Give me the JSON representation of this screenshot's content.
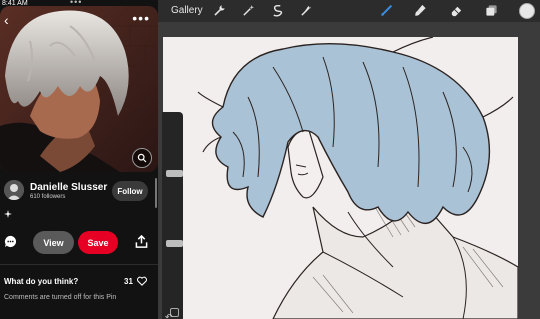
{
  "status": {
    "time": "8:41 AM",
    "dots": "•••"
  },
  "pin": {
    "author": "Danielle Slusser",
    "followers": "610 followers",
    "follow_label": "Follow",
    "view_label": "View",
    "save_label": "Save",
    "question": "What do you think?",
    "likes": "31",
    "comments_off": "Comments are turned off for this Pin",
    "more_label": "•••",
    "back_glyph": "‹",
    "icons": [
      "chevron-left-icon",
      "more-icon",
      "lens-icon",
      "sparkle-icon",
      "comment-icon",
      "share-icon",
      "heart-icon"
    ]
  },
  "procreate": {
    "gallery_label": "Gallery",
    "undo_glyph": "↶",
    "icons": [
      "wrench-icon",
      "magic-wand-icon",
      "selection-icon",
      "transform-icon",
      "brush-icon",
      "smudge-icon",
      "eraser-icon",
      "layers-icon",
      "color-icon"
    ],
    "colors": {
      "brush_active": "#3a8de0",
      "hair_fill": "#a9c2d6",
      "line": "#2b2321",
      "canvas": "#f1eeed"
    }
  },
  "colors": {
    "save_red": "#e60023",
    "pin_bg": "#121212"
  }
}
